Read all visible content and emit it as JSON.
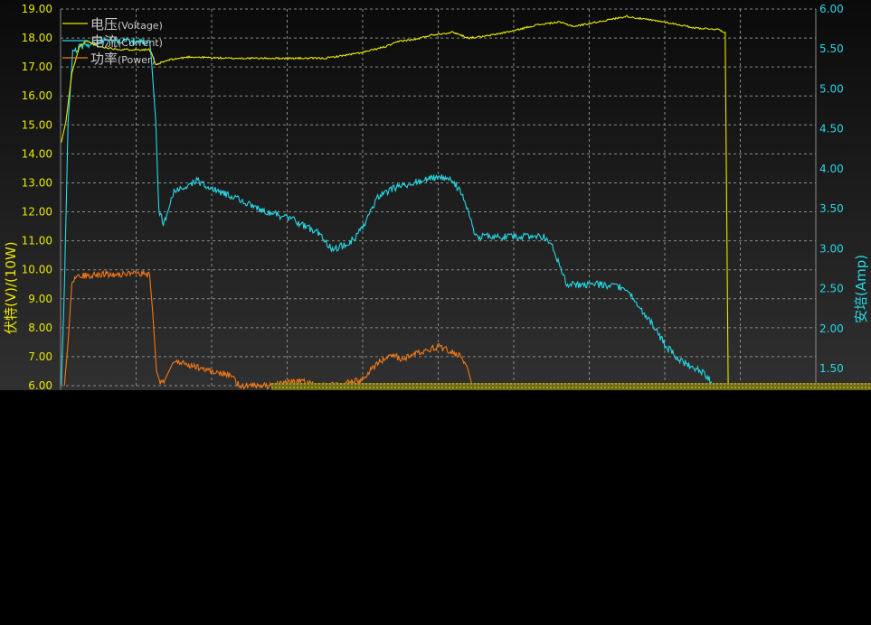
{
  "chart_data": {
    "type": "line",
    "title": "",
    "xlabel": "",
    "ylabel": "伏特(V)/(10W)",
    "y2label": "安培(Amp)",
    "ylim": [
      6.0,
      19.0
    ],
    "y2lim": [
      1.286,
      6.0
    ],
    "xlim": [
      0,
      100
    ],
    "grid": true,
    "legend_position": "top-left",
    "y_ticks": [
      "6.00",
      "7.00",
      "8.00",
      "9.00",
      "10.00",
      "11.00",
      "12.00",
      "13.00",
      "14.00",
      "15.00",
      "16.00",
      "17.00",
      "18.00",
      "19.00"
    ],
    "y2_ticks": [
      "1.50",
      "2.00",
      "2.50",
      "3.00",
      "3.50",
      "4.00",
      "4.50",
      "5.00",
      "5.50",
      "6.00"
    ],
    "series": [
      {
        "name": "电压",
        "name_sub": "(Voltage)",
        "color": "#e8e800",
        "axis": "left",
        "x": [
          0.1,
          0.7,
          1.5,
          2.5,
          3.5,
          5,
          8,
          11,
          11.7,
          12.1,
          12.6,
          13.3,
          14.5,
          17,
          22,
          28,
          35,
          40,
          43,
          45,
          47,
          49,
          52,
          54,
          56,
          57,
          58,
          60,
          63,
          66,
          68,
          70,
          72,
          74,
          75,
          76,
          80,
          84,
          87,
          88,
          88.2,
          88.4
        ],
        "y": [
          14.4,
          15.1,
          16.8,
          17.7,
          17.9,
          17.7,
          17.6,
          17.6,
          17.6,
          17.45,
          17.05,
          17.15,
          17.25,
          17.35,
          17.3,
          17.3,
          17.3,
          17.5,
          17.7,
          17.9,
          17.95,
          18.1,
          18.2,
          18.0,
          18.05,
          18.1,
          18.15,
          18.25,
          18.45,
          18.55,
          18.4,
          18.5,
          18.6,
          18.7,
          18.75,
          18.7,
          18.55,
          18.35,
          18.3,
          18.2,
          12.0,
          6.0
        ]
      },
      {
        "name": "电流",
        "name_sub": "(Current)",
        "color": "#27d7e4",
        "axis": "right",
        "x": [
          0.1,
          0.5,
          1.0,
          1.6,
          2.2,
          3,
          6,
          11,
          11.8,
          12.0,
          12.6,
          13.0,
          13.6,
          15,
          18,
          20,
          23,
          26,
          28,
          31,
          34,
          36,
          38,
          40,
          42,
          44,
          46,
          48,
          50,
          52,
          53,
          54,
          55,
          56,
          57,
          58,
          61,
          63,
          64,
          65,
          66,
          67,
          68,
          70,
          72,
          75,
          76,
          78,
          80,
          82,
          84,
          85,
          86,
          86.3
        ],
        "y": [
          1.3,
          2.5,
          4.6,
          5.45,
          5.5,
          5.55,
          5.6,
          5.6,
          5.6,
          5.4,
          4.6,
          3.5,
          3.3,
          3.7,
          3.85,
          3.75,
          3.65,
          3.5,
          3.45,
          3.35,
          3.2,
          3.0,
          3.05,
          3.25,
          3.65,
          3.75,
          3.8,
          3.85,
          3.9,
          3.85,
          3.7,
          3.45,
          3.15,
          3.15,
          3.15,
          3.15,
          3.15,
          3.15,
          3.15,
          3.05,
          2.8,
          2.55,
          2.55,
          2.55,
          2.55,
          2.5,
          2.35,
          2.1,
          1.8,
          1.6,
          1.5,
          1.45,
          1.35,
          1.3
        ]
      },
      {
        "name": "功率",
        "name_sub": "(Power)",
        "color": "#f07818",
        "axis": "left",
        "x": [
          0.5,
          1.0,
          1.5,
          2.0,
          3,
          6,
          11,
          11.8,
          12.2,
          12.7,
          13.2,
          13.8,
          15,
          16,
          20,
          22,
          23,
          23.5,
          24,
          25,
          27,
          28,
          30,
          32,
          33,
          35,
          37,
          40,
          42,
          44,
          45,
          46,
          48,
          50,
          52,
          53,
          54,
          54.5
        ],
        "y": [
          6.0,
          7.5,
          9.6,
          9.75,
          9.8,
          9.85,
          9.85,
          9.8,
          8.5,
          6.5,
          6.1,
          6.2,
          6.85,
          6.8,
          6.5,
          6.4,
          6.2,
          6.05,
          6.0,
          6.0,
          6.0,
          6.0,
          6.1,
          6.15,
          6.05,
          6.0,
          6.05,
          6.2,
          6.8,
          7.1,
          6.9,
          7.0,
          7.2,
          7.35,
          7.15,
          7.0,
          6.5,
          6.0
        ]
      }
    ]
  }
}
